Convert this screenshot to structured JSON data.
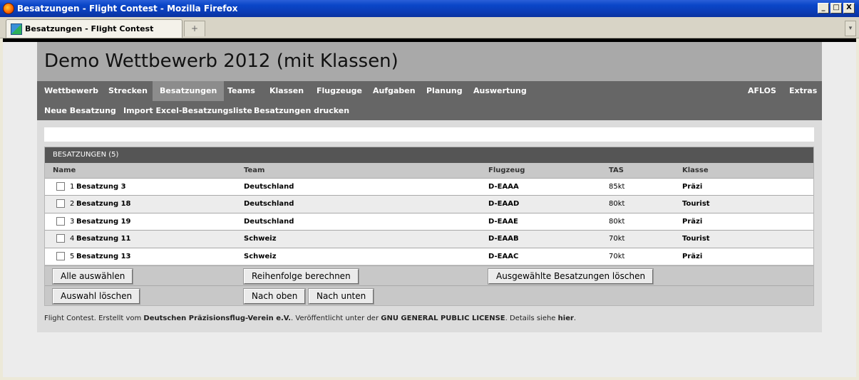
{
  "window": {
    "title": "Besatzungen - Flight Contest - Mozilla Firefox",
    "buttons": {
      "minimize": "_",
      "maximize": "□",
      "close": "X"
    }
  },
  "browser": {
    "tab_label": "Besatzungen - Flight Contest",
    "new_tab_symbol": "+",
    "tab_menu_symbol": "▾"
  },
  "page": {
    "title": "Demo Wettbewerb 2012 (mit Klassen)",
    "nav": {
      "main": [
        "Wettbewerb",
        "Strecken",
        "Besatzungen",
        "Teams",
        "Klassen",
        "Flugzeuge",
        "Aufgaben",
        "Planung",
        "Auswertung"
      ],
      "right": [
        "AFLOS",
        "Extras"
      ],
      "active": "Besatzungen",
      "sub": [
        "Neue Besatzung",
        "Import Excel-Besatzungsliste",
        "Besatzungen drucken"
      ]
    },
    "table": {
      "title": "BESATZUNGEN (5)",
      "columns": [
        "Name",
        "Team",
        "Flugzeug",
        "TAS",
        "Klasse"
      ],
      "rows": [
        {
          "nr": "1",
          "name": "Besatzung 3",
          "team": "Deutschland",
          "aircraft": "D-EAAA",
          "tas": "85kt",
          "class": "Präzi"
        },
        {
          "nr": "2",
          "name": "Besatzung 18",
          "team": "Deutschland",
          "aircraft": "D-EAAD",
          "tas": "80kt",
          "class": "Tourist"
        },
        {
          "nr": "3",
          "name": "Besatzung 19",
          "team": "Deutschland",
          "aircraft": "D-EAAE",
          "tas": "80kt",
          "class": "Präzi"
        },
        {
          "nr": "4",
          "name": "Besatzung 11",
          "team": "Schweiz",
          "aircraft": "D-EAAB",
          "tas": "70kt",
          "class": "Tourist"
        },
        {
          "nr": "5",
          "name": "Besatzung 13",
          "team": "Schweiz",
          "aircraft": "D-EAAC",
          "tas": "70kt",
          "class": "Präzi"
        }
      ]
    },
    "buttons": {
      "select_all": "Alle auswählen",
      "calc_order": "Reihenfolge berechnen",
      "delete_selected": "Ausgewählte Besatzungen löschen",
      "clear_selection": "Auswahl löschen",
      "move_up": "Nach oben",
      "move_down": "Nach unten"
    },
    "footer": {
      "part1": "Flight Contest. Erstellt vom ",
      "org": "Deutschen Präzisionsflug-Verein e.V.",
      "part2": ". Veröffentlicht unter der ",
      "license": "GNU GENERAL PUBLIC LICENSE",
      "part3": ". Details siehe ",
      "link": "hier",
      "part4": "."
    }
  }
}
